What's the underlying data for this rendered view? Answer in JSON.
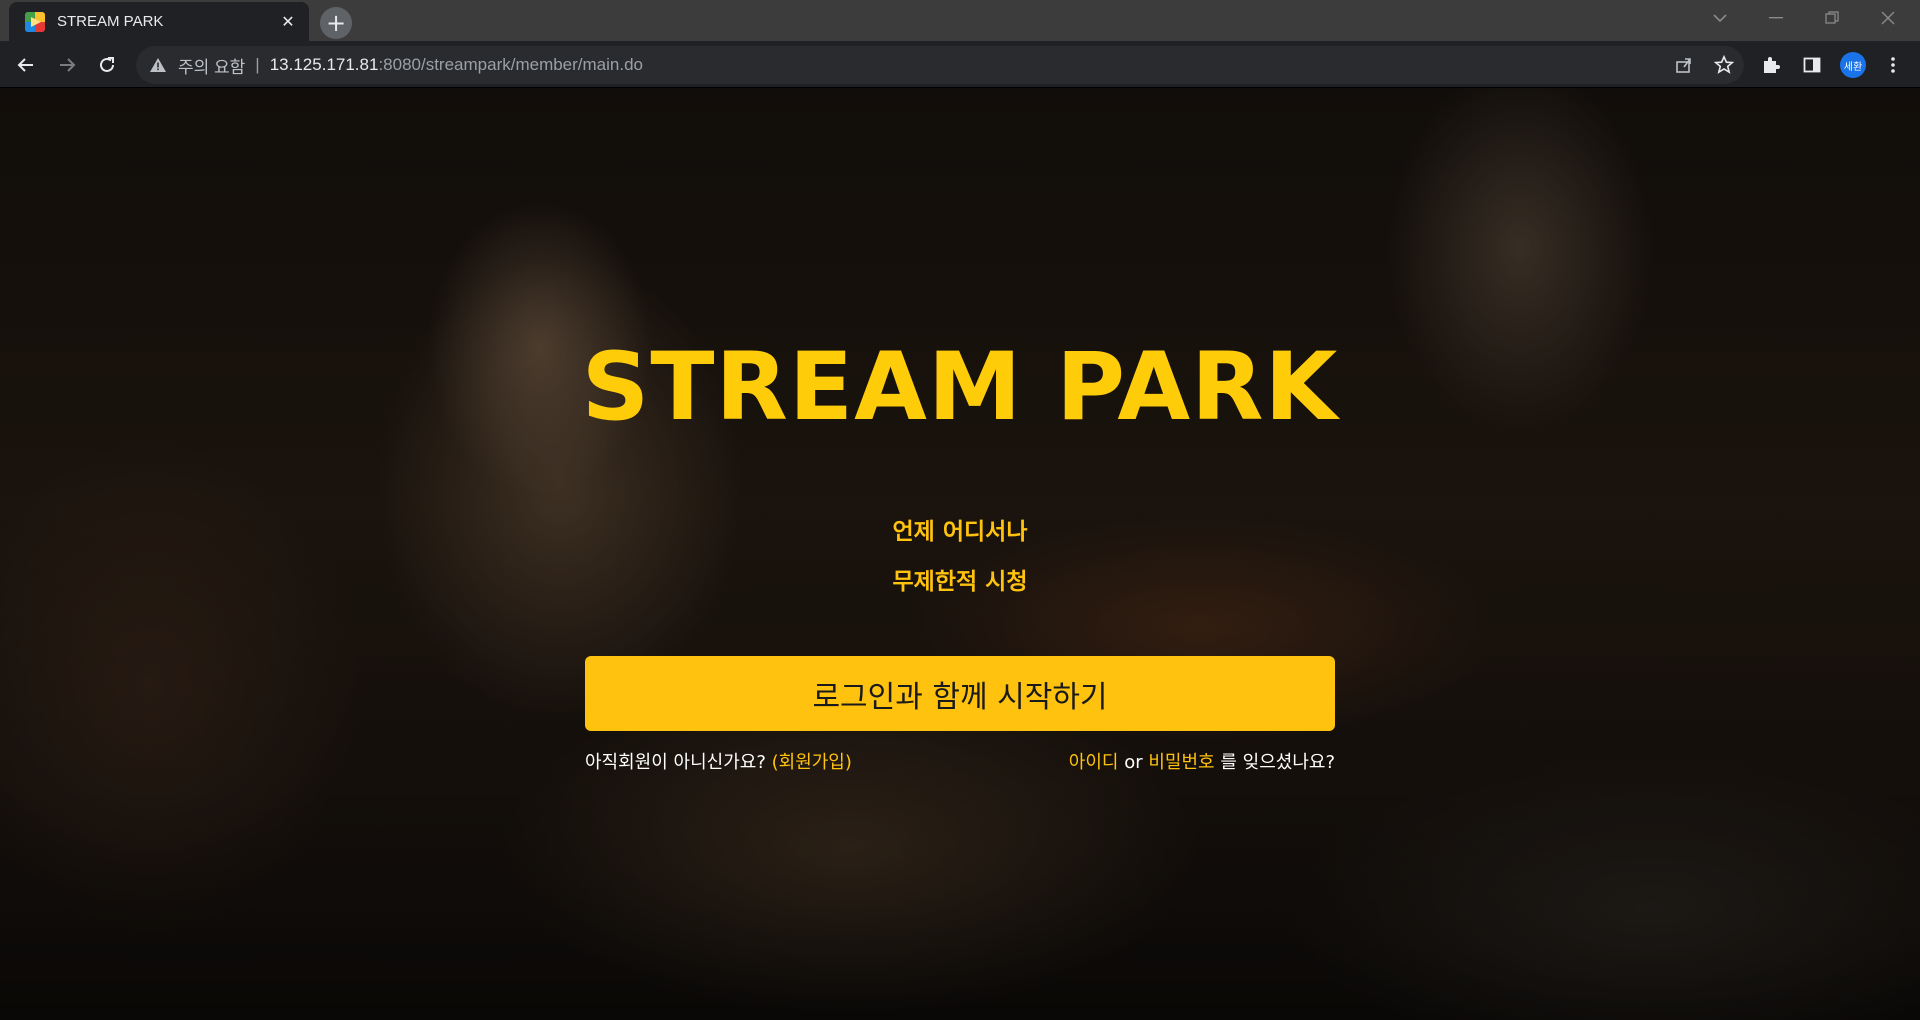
{
  "browser": {
    "tab_title": "STREAM PARK",
    "security_label": "주의 요함",
    "separator": "|",
    "url_host": "13.125.171.81",
    "url_rest": ":8080/streampark/member/main.do",
    "profile_initials": "세환"
  },
  "hero": {
    "title": "STREAM PARK",
    "tagline_1": "언제 어디서나",
    "tagline_2": "무제한적 시청"
  },
  "login": {
    "start_button": "로그인과 함께 시작하기",
    "not_member_text": "아직회원이 아니신가요?",
    "signup_link": "(회원가입)",
    "find_id_link": "아이디",
    "or_text": "or",
    "find_password_link": "비밀번호",
    "forgot_suffix": "를 잊으셨나요?"
  },
  "colors": {
    "accent": "#ffc20e",
    "title": "#ffcc0a"
  }
}
